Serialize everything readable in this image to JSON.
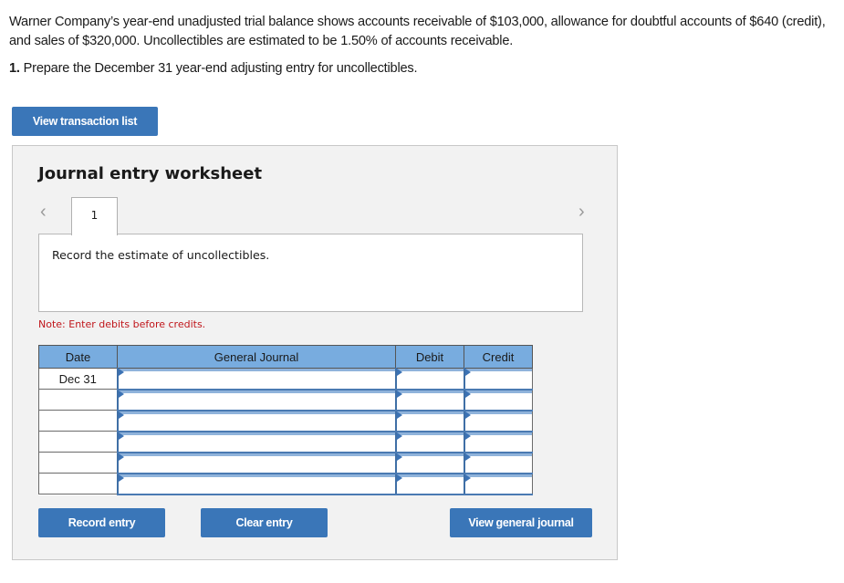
{
  "problem": {
    "text": "Warner Company’s year-end unadjusted trial balance shows accounts receivable of $103,000, allowance for doubtful accounts of $640 (credit), and sales of $320,000. Uncollectibles are estimated to be 1.50% of accounts receivable.",
    "question_number": "1.",
    "question_text": " Prepare the December 31 year-end adjusting entry for uncollectibles."
  },
  "buttons": {
    "view_transaction_list": "View transaction list",
    "record_entry": "Record entry",
    "clear_entry": "Clear entry",
    "view_general_journal": "View general journal"
  },
  "worksheet": {
    "title": "Journal entry worksheet",
    "prev_icon": "chevron-left-icon",
    "next_icon": "chevron-right-icon",
    "tabs": [
      {
        "label": "1",
        "active": true
      }
    ],
    "description": "Record the estimate of uncollectibles.",
    "note": "Note: Enter debits before credits.",
    "columns": [
      "Date",
      "General Journal",
      "Debit",
      "Credit"
    ],
    "rows": [
      {
        "date": "Dec 31",
        "account": "",
        "debit": "",
        "credit": ""
      },
      {
        "date": "",
        "account": "",
        "debit": "",
        "credit": ""
      },
      {
        "date": "",
        "account": "",
        "debit": "",
        "credit": ""
      },
      {
        "date": "",
        "account": "",
        "debit": "",
        "credit": ""
      },
      {
        "date": "",
        "account": "",
        "debit": "",
        "credit": ""
      },
      {
        "date": "",
        "account": "",
        "debit": "",
        "credit": ""
      }
    ]
  },
  "colors": {
    "button": "#3a76b8",
    "header": "#78acdf",
    "note": "#c0161b",
    "panel": "#f2f2f2"
  }
}
